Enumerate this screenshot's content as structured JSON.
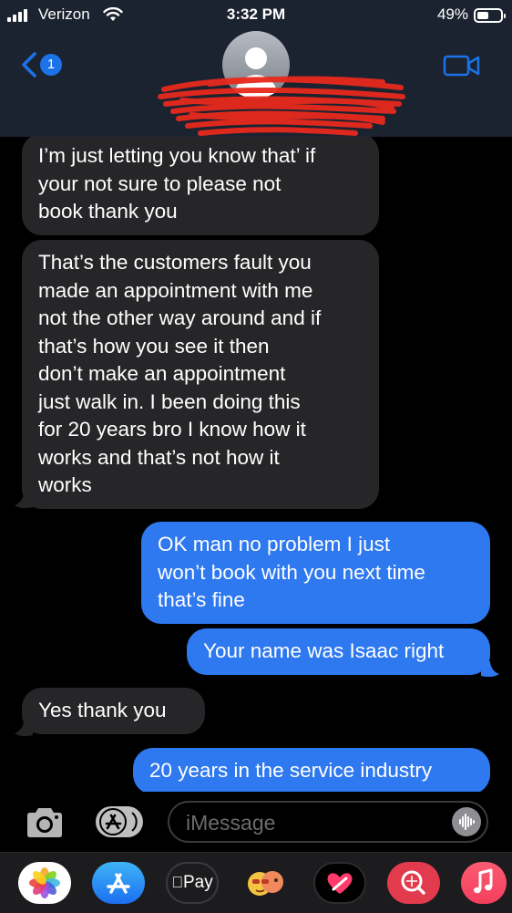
{
  "status_bar": {
    "carrier": "Verizon",
    "time": "3:32 PM",
    "battery_percent": "49%",
    "battery_level": 0.49
  },
  "nav": {
    "back_badge": "1",
    "back_icon": "chevron-left-icon",
    "contact_avatar_icon": "person-silhouette-icon",
    "video_icon": "video-camera-icon",
    "accent_color": "#1a73e8"
  },
  "messages": [
    {
      "direction": "incoming",
      "lines": [
        "I’m just letting you know that’ if",
        "your not sure to please not",
        "book thank you"
      ]
    },
    {
      "direction": "incoming",
      "lines": [
        "That’s the customers fault you",
        "made an appointment with me",
        "not the other way around and if",
        "that’s how you see it then",
        "don’t make an appointment",
        "just walk in. I been doing this",
        "for 20 years bro I know how it",
        "works and that’s not how it",
        "works"
      ]
    },
    {
      "direction": "outgoing",
      "lines": [
        "OK man no problem I just",
        "won’t book with you next time",
        "that’s fine"
      ]
    },
    {
      "direction": "outgoing",
      "lines": [
        "Your name was Isaac right"
      ]
    },
    {
      "direction": "incoming",
      "lines": [
        "Yes thank you"
      ]
    },
    {
      "direction": "outgoing",
      "lines": [
        "20 years in the service industry"
      ]
    }
  ],
  "composer": {
    "placeholder": "iMessage",
    "camera_icon": "camera-icon",
    "appstore_icon": "app-store-icon",
    "audio_icon": "audio-waveform-icon"
  },
  "app_drawer": {
    "apps": [
      {
        "name": "Photos",
        "icon": "photos-icon"
      },
      {
        "name": "App Store",
        "icon": "app-store-icon"
      },
      {
        "name": "Apple Pay",
        "label": "Pay",
        "icon": "apple-pay-icon"
      },
      {
        "name": "Memoji",
        "icon": "memoji-icon"
      },
      {
        "name": "Digital Touch",
        "icon": "digital-touch-heart-icon"
      },
      {
        "name": "Images",
        "icon": "image-search-icon"
      },
      {
        "name": "Music",
        "icon": "music-note-icon"
      }
    ]
  },
  "colors": {
    "incoming_bubble": "#262628",
    "outgoing_bubble": "#2e78f0",
    "header_bg": "#1c2330",
    "redaction": "#e8291c"
  }
}
